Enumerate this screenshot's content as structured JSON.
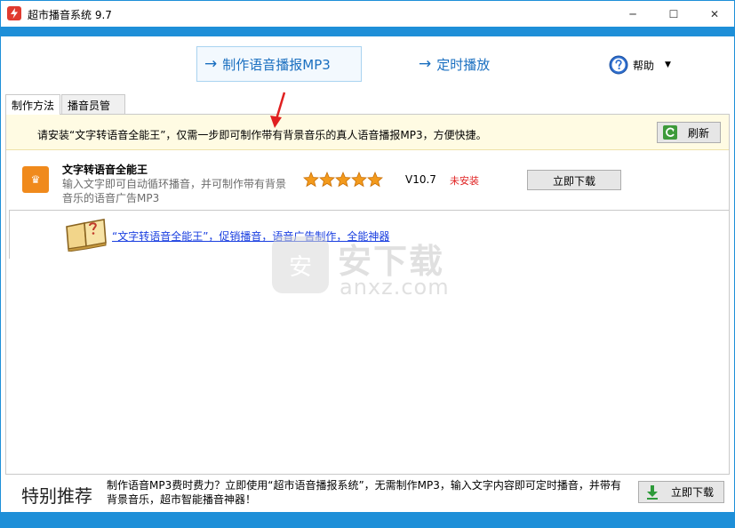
{
  "window": {
    "title": "超市播音系统 9.7",
    "controls": {
      "minimize": "─",
      "maximize": "☐",
      "close": "✕"
    }
  },
  "colors": {
    "accent_blue": "#1e8fd8",
    "link_blue": "#1a3fe0",
    "notice_bg": "#fffbe3",
    "status_red": "#e02222",
    "icon_orange": "#f08a1c"
  },
  "toolbar": {
    "make_mp3": {
      "arrow": "→",
      "label": "制作语音播报MP3"
    },
    "timer_play": {
      "arrow": "→",
      "label": "定时播放"
    },
    "help": {
      "icon": "question-circle-icon",
      "label": "帮助",
      "caret": "▼"
    }
  },
  "tabs": [
    {
      "label": "制作方法",
      "active": true
    },
    {
      "label": "播音员管理",
      "active": false
    }
  ],
  "notice": {
    "text": "请安装“文字转语音全能王”，仅需一步即可制作带有背景音乐的真人语音播报MP3，方便快捷。",
    "refresh_label": "刷新",
    "refresh_icon": "refresh-icon"
  },
  "software": {
    "icon": "crown-icon",
    "icon_glyph": "♛",
    "name": "文字转语音全能王",
    "description": "输入文字即可自动循环播音，并可制作带有背景音乐的语音广告MP3",
    "rating": 5,
    "version": "V10.7",
    "status": "未安装",
    "download_label": "立即下载"
  },
  "promo": {
    "icon": "book-question-icon",
    "link_text": "“文字转语音全能王”，促销播音，语音广告制作，全能神器"
  },
  "recommend": {
    "title": "特别推荐",
    "description": "制作语音MP3费时费力？立即使用“超市语音播报系统”，无需制作MP3，输入文字内容即可定时播音，并带有背景音乐，超市智能播音神器！",
    "download_label": "立即下载",
    "download_icon": "download-arrow-icon"
  },
  "watermark": {
    "badge": "安",
    "text": "安下载",
    "domain": "anxz.com"
  }
}
